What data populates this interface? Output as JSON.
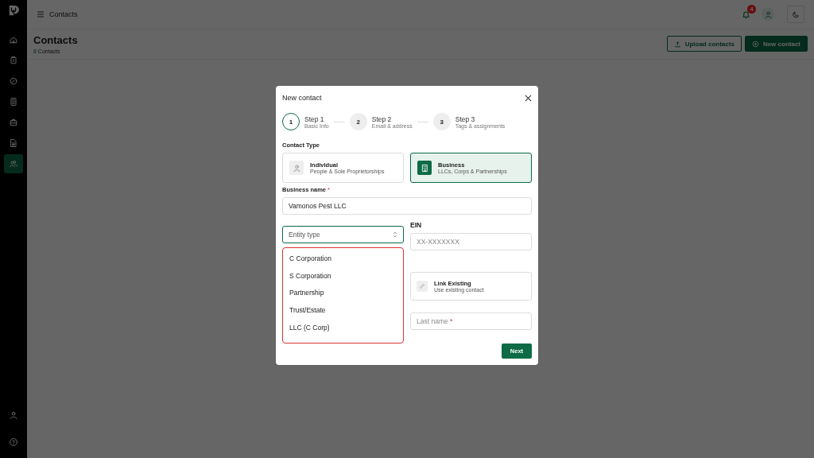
{
  "sidebar": {
    "items": [
      {
        "selected": false
      },
      {
        "selected": false
      },
      {
        "selected": false
      },
      {
        "selected": false
      },
      {
        "selected": false
      },
      {
        "selected": false
      },
      {
        "selected": true
      }
    ]
  },
  "topbar": {
    "title": "Contacts",
    "notification_count": "4"
  },
  "header": {
    "title": "Contacts",
    "count": "8",
    "count_label": "Contacts"
  },
  "actions": [
    {
      "label": "Upload contacts",
      "kind": "outline"
    },
    {
      "label": "New contact",
      "kind": "primary"
    }
  ],
  "dialog": {
    "title": "New contact",
    "steps": [
      {
        "number": "1",
        "title": "Step 1",
        "subtitle": "Basic Info",
        "selected": true
      },
      {
        "number": "2",
        "title": "Step 2",
        "subtitle": "Email & address",
        "selected": false
      },
      {
        "number": "3",
        "title": "Step 3",
        "subtitle": "Tags & assignments",
        "selected": false
      }
    ],
    "contact_type_label": "Contact Type",
    "contact_types": [
      {
        "title": "Individual",
        "subtitle": "People & Sole Proprietorships",
        "selected": false
      },
      {
        "title": "Business",
        "subtitle": "LLCs, Corps & Partnerships",
        "selected": true
      }
    ],
    "business_name": {
      "label": "Business name",
      "required_mark": "*",
      "value": "Vamonos Pest LLC"
    },
    "entity_type": {
      "placeholder": "Entity type",
      "expanded": true,
      "options": [
        "C Corporation",
        "S Corporation",
        "Partnership",
        "Trust/Estate",
        "LLC (C Corp)"
      ]
    },
    "ein": {
      "label": "EIN",
      "placeholder": "XX-XXXXXXX"
    },
    "link_existing": {
      "title": "Link Existing",
      "subtitle": "Use existing contact"
    },
    "last_name": {
      "label": "Last name",
      "required_mark": "*"
    },
    "next": "Next"
  }
}
